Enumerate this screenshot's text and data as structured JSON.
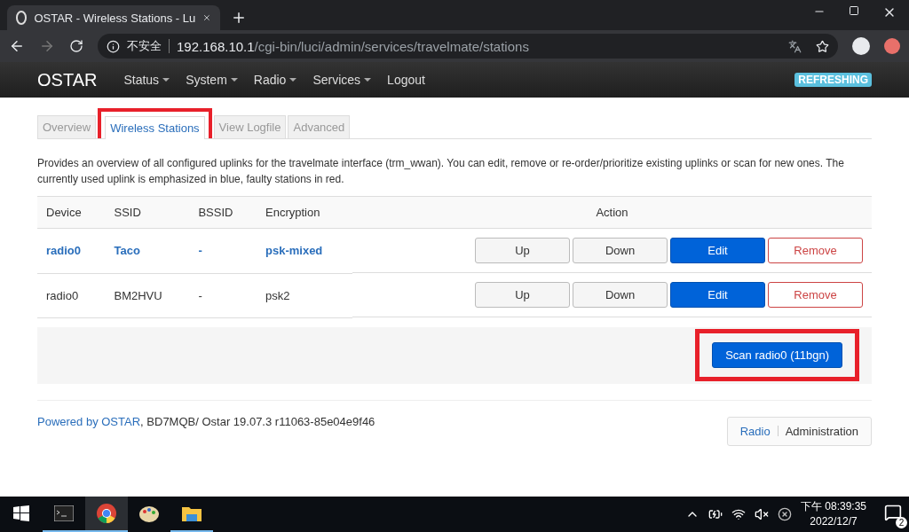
{
  "browser": {
    "tab_title": "OSTAR - Wireless Stations - Lu",
    "security_label": "不安全",
    "url_host": "192.168.10.1",
    "url_path": "/cgi-bin/luci/admin/services/travelmate/stations"
  },
  "navbar": {
    "brand": "OSTAR",
    "menus": [
      {
        "label": "Status",
        "dropdown": true
      },
      {
        "label": "System",
        "dropdown": true
      },
      {
        "label": "Radio",
        "dropdown": true
      },
      {
        "label": "Services",
        "dropdown": true
      },
      {
        "label": "Logout",
        "dropdown": false
      }
    ],
    "badge": "REFRESHING"
  },
  "tabs": [
    {
      "label": "Overview",
      "selected": false,
      "highlighted": false
    },
    {
      "label": "Wireless Stations",
      "selected": true,
      "highlighted": true
    },
    {
      "label": "View Logfile",
      "selected": false,
      "highlighted": false
    },
    {
      "label": "Advanced",
      "selected": false,
      "highlighted": false
    }
  ],
  "description": "Provides an overview of all configured uplinks for the travelmate interface (trm_wwan). You can edit, remove or re-order/prioritize existing uplinks or scan for new ones. The currently used uplink is emphasized in blue, faulty stations in red.",
  "table": {
    "columns": [
      "Device",
      "SSID",
      "BSSID",
      "Encryption",
      "Action"
    ],
    "rows": [
      {
        "cells": [
          "radio0",
          "Taco",
          "-",
          "psk-mixed"
        ],
        "emphasized": true,
        "actions": [
          {
            "label": "Up",
            "kind": "neutral"
          },
          {
            "label": "Down",
            "kind": "neutral"
          },
          {
            "label": "Edit",
            "kind": "primary"
          },
          {
            "label": "Remove",
            "kind": "danger"
          }
        ]
      },
      {
        "cells": [
          "radio0",
          "BM2HVU",
          "-",
          "psk2"
        ],
        "emphasized": false,
        "actions": [
          {
            "label": "Up",
            "kind": "neutral"
          },
          {
            "label": "Down",
            "kind": "neutral"
          },
          {
            "label": "Edit",
            "kind": "primary"
          },
          {
            "label": "Remove",
            "kind": "danger"
          }
        ]
      }
    ]
  },
  "scan_button": {
    "label": "Scan radio0 (11bgn)",
    "highlighted": true
  },
  "footer": {
    "link": "Powered by OSTAR",
    "text": ", BD7MQB/ Ostar 19.07.3 r11063-85e04e9f46",
    "crumbs": [
      {
        "label": "Radio",
        "selected": false
      },
      {
        "label": "Administration",
        "selected": true
      }
    ]
  },
  "taskbar": {
    "apps": [
      {
        "kind": "terminal",
        "running": true,
        "selected": false
      },
      {
        "kind": "chrome",
        "running": true,
        "selected": true
      },
      {
        "kind": "paint",
        "running": false,
        "selected": false
      },
      {
        "kind": "folder",
        "running": true,
        "selected": false
      }
    ],
    "time": "下午 08:39:35",
    "date": "2022/12/7",
    "notifications": "2"
  }
}
